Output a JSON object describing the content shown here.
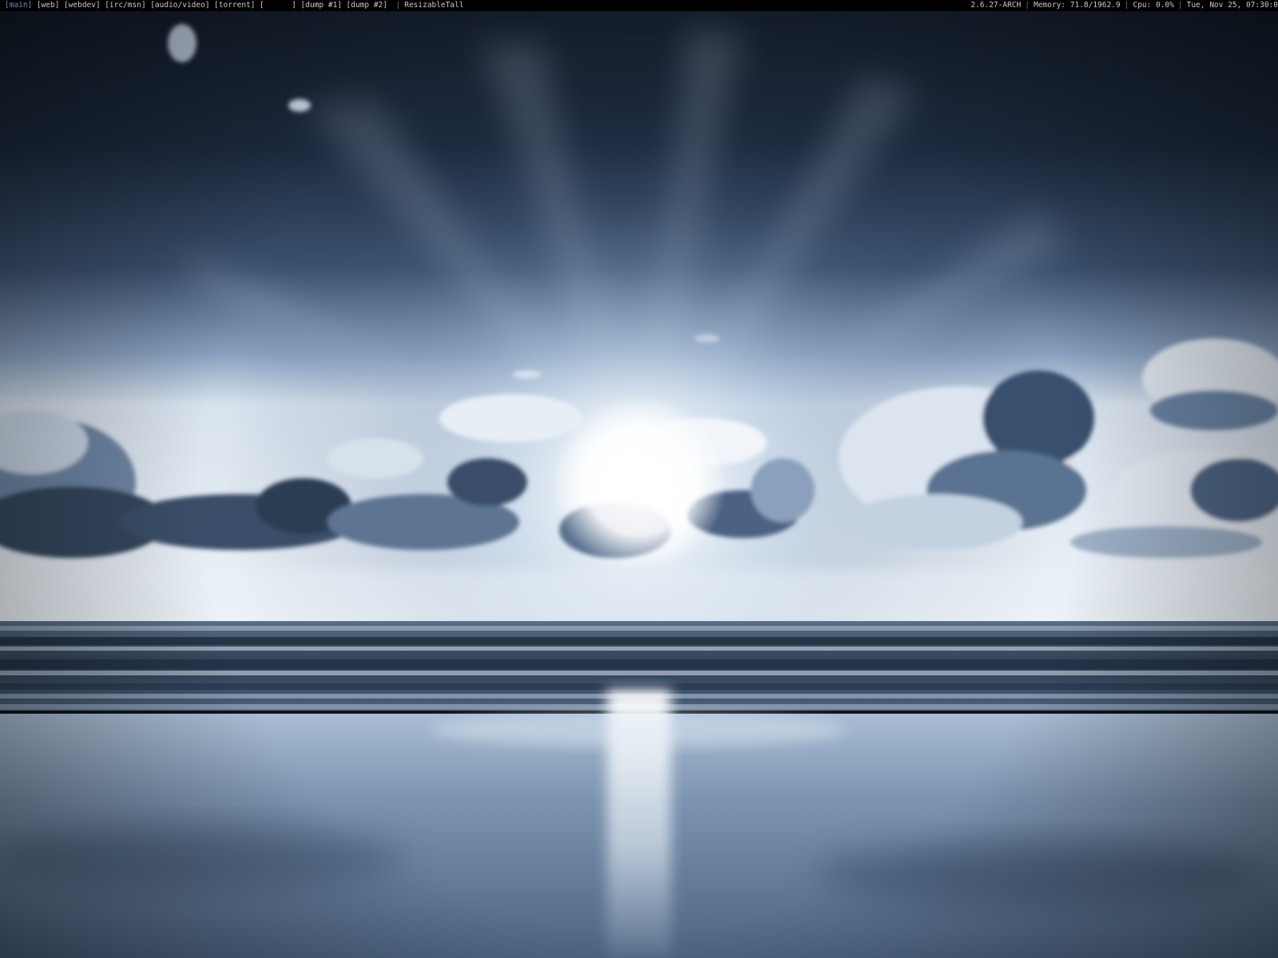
{
  "statusbar": {
    "workspaces": [
      {
        "label": "[main]",
        "current": true
      },
      {
        "label": "[web]",
        "current": false
      },
      {
        "label": "[webdev]",
        "current": false
      },
      {
        "label": "[irc/msn]",
        "current": false
      },
      {
        "label": "[audio/video]",
        "current": false
      },
      {
        "label": "[torrent]",
        "current": false
      },
      {
        "label": "[      ]",
        "current": false
      },
      {
        "label": "[dump #1]",
        "current": false
      },
      {
        "label": "[dump #2]",
        "current": false
      }
    ],
    "separator": "|",
    "layout": "ResizableTall",
    "kernel": "2.6.27-ARCH",
    "memory": "Memory: 71.8/1962.9",
    "cpu": "Cpu: 0.0%",
    "datetime": "Tue, Nov 25, 07:30:0",
    "colors": {
      "background": "#000000",
      "text": "#c8c8c8",
      "current_workspace": "#6f8fc8",
      "separator": "#5a78b0"
    }
  },
  "wallpaper": {
    "subject": "sunburst-over-ocean",
    "palette": {
      "sky_dark": "#162235",
      "sky_mid": "#6a85a8",
      "sun": "#ffffff",
      "sea": "#3e5670",
      "sand": "#8ea4c0"
    }
  }
}
